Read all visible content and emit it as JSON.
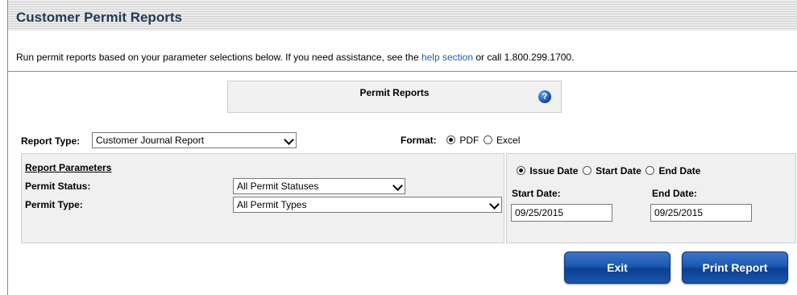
{
  "header": {
    "title": "Customer Permit Reports"
  },
  "intro": {
    "text_before": "Run permit reports based on your parameter selections below. If you need assistance, see the ",
    "help_link": "help section",
    "text_after": " or call 1.800.299.1700."
  },
  "permit_box": {
    "heading": "Permit Reports",
    "help_icon": "question-icon"
  },
  "report_type": {
    "label": "Report Type:",
    "value": "Customer Journal Report"
  },
  "format": {
    "label": "Format:",
    "options": [
      "PDF",
      "Excel"
    ],
    "selected": "PDF"
  },
  "parameters": {
    "heading": "Report Parameters",
    "permit_status": {
      "label": "Permit Status:",
      "value": "All Permit Statuses"
    },
    "permit_type": {
      "label": "Permit Type:",
      "value": "All Permit Types"
    }
  },
  "date_filter": {
    "options": [
      "Issue Date",
      "Start Date",
      "End Date"
    ],
    "selected": "Issue Date",
    "start_label": "Start Date:",
    "start_value": "09/25/2015",
    "end_label": "End Date:",
    "end_value": "09/25/2015"
  },
  "buttons": {
    "exit": "Exit",
    "print": "Print Report"
  },
  "colors": {
    "title": "#223a55",
    "link": "#1f5fa8",
    "button": "#1a58b0"
  }
}
